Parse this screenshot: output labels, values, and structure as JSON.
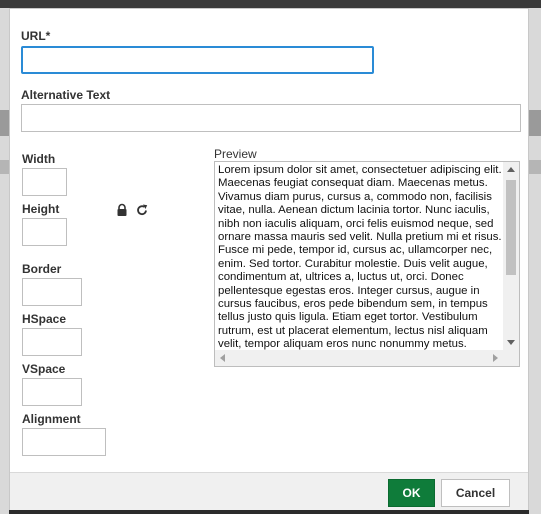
{
  "dialog": {
    "url": {
      "label": "URL*",
      "value": ""
    },
    "alt_text": {
      "label": "Alternative Text",
      "value": ""
    },
    "width": {
      "label": "Width",
      "value": ""
    },
    "height": {
      "label": "Height",
      "value": ""
    },
    "border": {
      "label": "Border",
      "value": ""
    },
    "hspace": {
      "label": "HSpace",
      "value": ""
    },
    "vspace": {
      "label": "VSpace",
      "value": ""
    },
    "alignment": {
      "label": "Alignment",
      "value": ""
    },
    "icons": {
      "lock": "lock-icon",
      "reset": "reset-size-icon"
    },
    "preview": {
      "label": "Preview",
      "text": "Lorem ipsum dolor sit amet, consectetuer adipiscing elit. Maecenas feugiat consequat diam. Maecenas metus. Vivamus diam purus, cursus a, commodo non, facilisis vitae, nulla. Aenean dictum lacinia tortor. Nunc iaculis, nibh non iaculis aliquam, orci felis euismod neque, sed ornare massa mauris sed velit. Nulla pretium mi et risus. Fusce mi pede, tempor id, cursus ac, ullamcorper nec, enim. Sed tortor. Curabitur molestie. Duis velit augue, condimentum at, ultrices a, luctus ut, orci. Donec pellentesque egestas eros. Integer cursus, augue in cursus faucibus, eros pede bibendum sem, in tempus tellus justo quis ligula. Etiam eget tortor. Vestibulum rutrum, est ut placerat elementum, lectus nisl aliquam velit, tempor aliquam eros nunc nonummy metus."
    },
    "buttons": {
      "ok": "OK",
      "cancel": "Cancel"
    },
    "colors": {
      "ok_bg": "#0f7c3a",
      "focus_border": "#2a8bd6"
    }
  }
}
